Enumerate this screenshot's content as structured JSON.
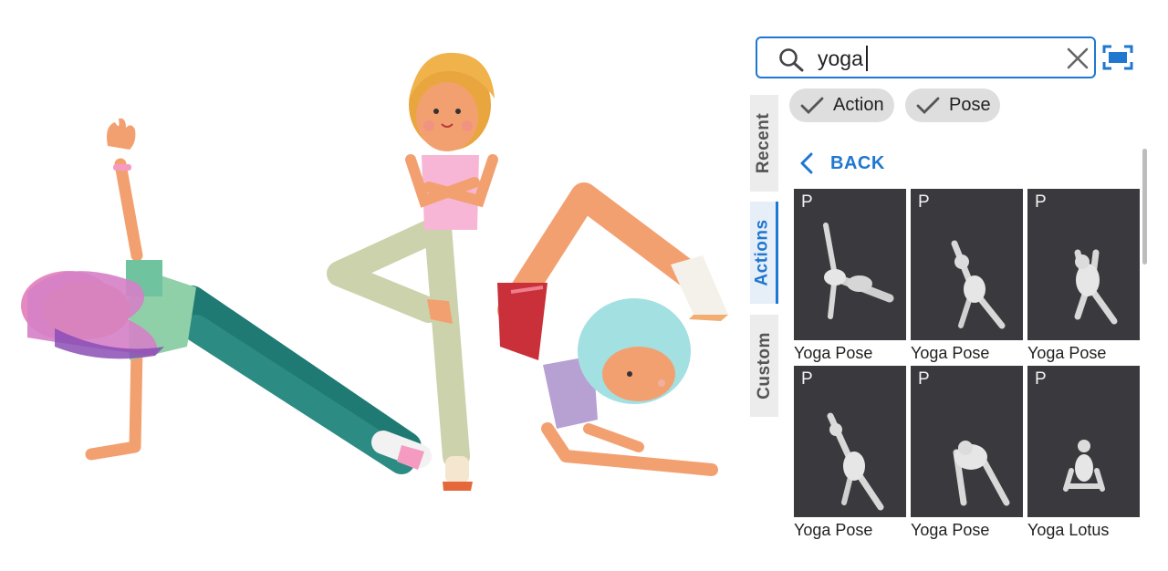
{
  "search": {
    "value": "yoga"
  },
  "filters": [
    {
      "label": "Action",
      "icon": "check-icon"
    },
    {
      "label": "Pose",
      "icon": "check-icon"
    }
  ],
  "tabs": [
    {
      "label": "Recent",
      "active": false
    },
    {
      "label": "Actions",
      "active": true
    },
    {
      "label": "Custom",
      "active": false
    }
  ],
  "panel": {
    "back_label": "BACK",
    "accent_color": "#1f77d0"
  },
  "results": [
    {
      "badge": "P",
      "label": "Yoga Pose"
    },
    {
      "badge": "P",
      "label": "Yoga Pose"
    },
    {
      "badge": "P",
      "label": "Yoga Pose"
    },
    {
      "badge": "P",
      "label": "Yoga Pose"
    },
    {
      "badge": "P",
      "label": "Yoga Pose"
    },
    {
      "badge": "P",
      "label": "Yoga Lotus"
    }
  ]
}
